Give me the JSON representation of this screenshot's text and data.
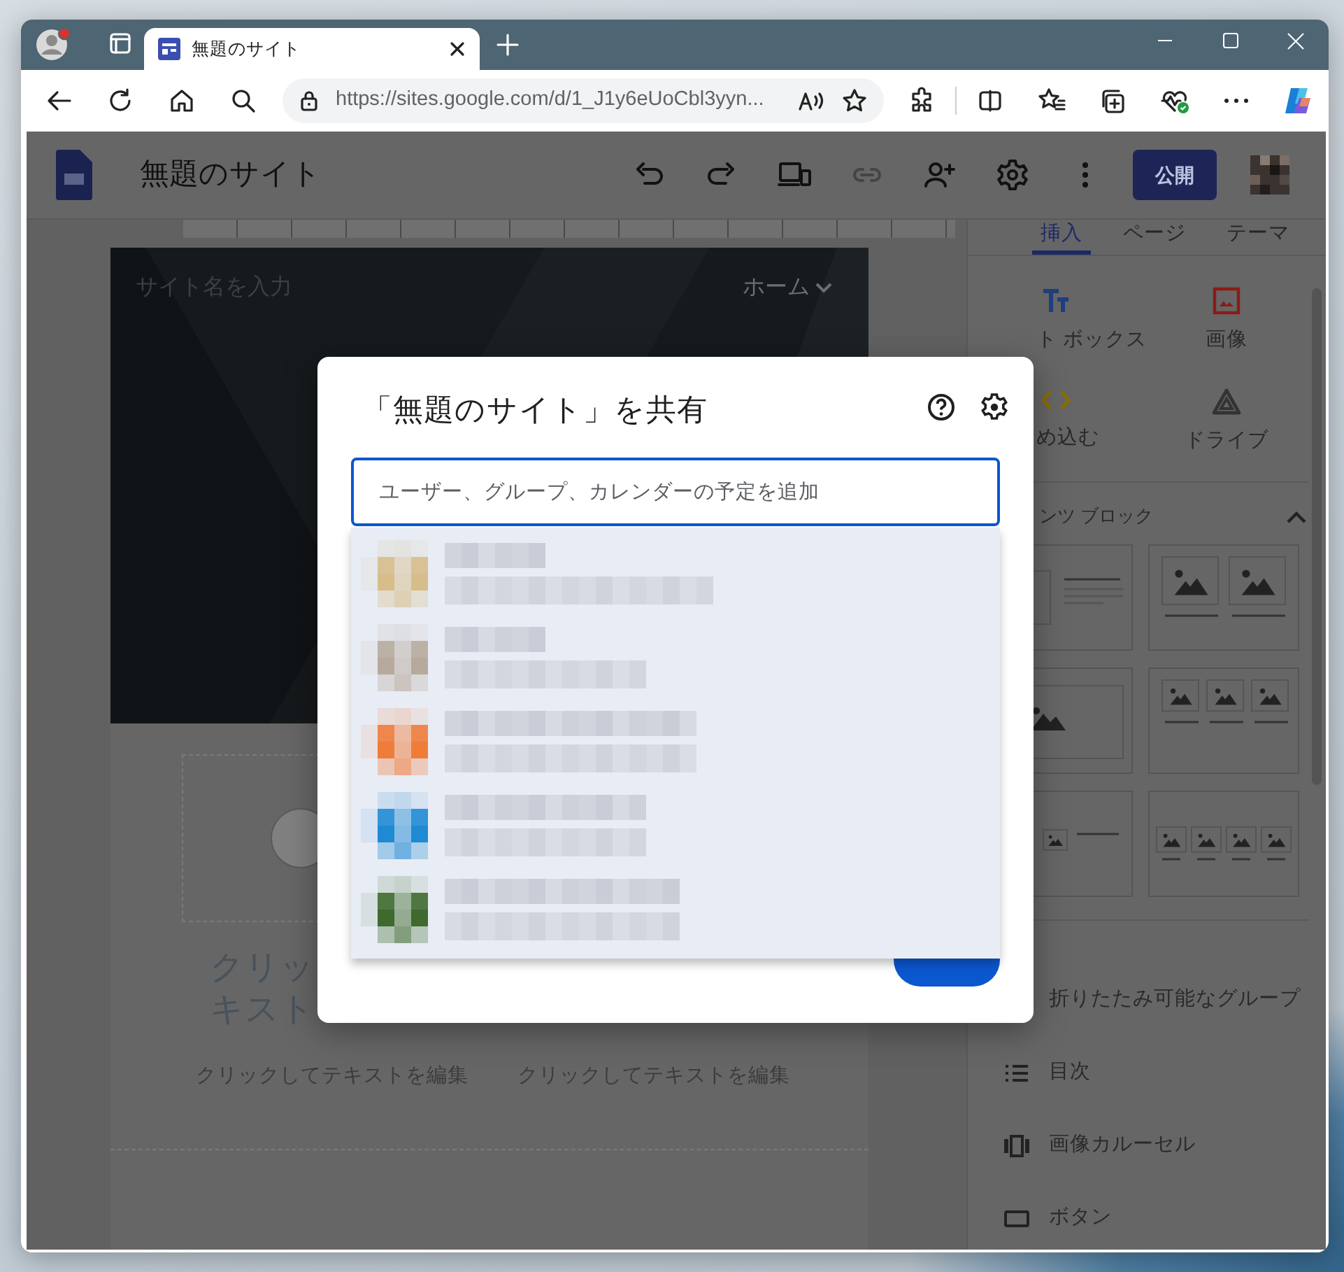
{
  "browser": {
    "tab": {
      "title": "無題のサイト"
    },
    "url": "https://sites.google.com/d/1_J1y6eUoCbl3yyn..."
  },
  "app": {
    "title": "無題のサイト",
    "publish_button": "公開"
  },
  "page": {
    "site_name_placeholder": "サイト名を入力",
    "nav_item": "ホーム",
    "heading_fragments": [
      "クリッ",
      "キスト"
    ],
    "captions": [
      "クリックしてテキストを編集",
      "クリックしてテキストを編集"
    ]
  },
  "sidebar": {
    "tabs": [
      {
        "label": "挿入",
        "selected": true
      },
      {
        "label": "ページ",
        "selected": false
      },
      {
        "label": "テーマ",
        "selected": false
      }
    ],
    "insert_items": [
      {
        "label": "ト ボックス",
        "kind": "text"
      },
      {
        "label": "画像",
        "kind": "image"
      },
      {
        "label": "め込む",
        "kind": "embed"
      },
      {
        "label": "ドライブ",
        "kind": "drive"
      }
    ],
    "blocks_header": {
      "label": "ンツ ブロック",
      "expanded": true
    },
    "layouts": [
      {
        "kind": "image-text"
      },
      {
        "kind": "two-images"
      },
      {
        "kind": "image"
      },
      {
        "kind": "three-images"
      },
      {
        "kind": "text-image-text"
      },
      {
        "kind": "four-images"
      }
    ],
    "components": [
      {
        "label": "折りたたみ可能なグループ",
        "kind": "collapsible"
      },
      {
        "label": "目次",
        "kind": "toc"
      },
      {
        "label": "画像カルーセル",
        "kind": "carousel"
      },
      {
        "label": "ボタン",
        "kind": "button"
      }
    ]
  },
  "dialog": {
    "title": "「無題のサイト」を共有",
    "placeholder": "ユーザー、グループ、カレンダーの予定を追加",
    "suggestions": [
      {
        "color": "#d6bd8a"
      },
      {
        "color": "#b7aa9c"
      },
      {
        "color": "#f07c3a"
      },
      {
        "color": "#1f8ad4"
      },
      {
        "color": "#3e6a2e"
      }
    ]
  }
}
